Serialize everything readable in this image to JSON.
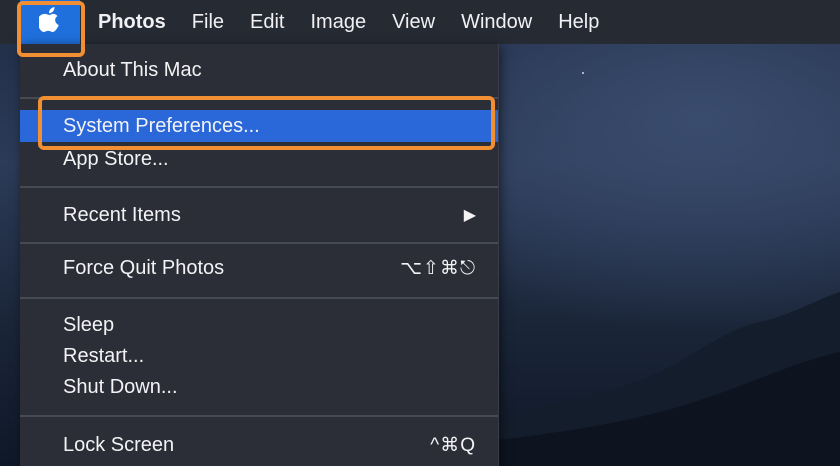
{
  "menubar": {
    "apple_icon": "apple-logo-icon",
    "app_name": "Photos",
    "menus": [
      "File",
      "Edit",
      "Image",
      "View",
      "Window",
      "Help"
    ]
  },
  "apple_menu": {
    "about": "About This Mac",
    "system_preferences": "System Preferences...",
    "app_store": "App Store...",
    "recent_items": "Recent Items",
    "recent_items_arrow": "▶",
    "force_quit": "Force Quit Photos",
    "force_quit_shortcut": "⌥⇧⌘⎋",
    "sleep": "Sleep",
    "restart": "Restart...",
    "shut_down": "Shut Down...",
    "lock_screen": "Lock Screen",
    "lock_screen_shortcut": "^⌘Q"
  },
  "colors": {
    "menubar_bg": "#262a33",
    "menu_bg": "#2b2e36",
    "selection": "#2a67d8",
    "highlight_outline": "#f18f32"
  }
}
